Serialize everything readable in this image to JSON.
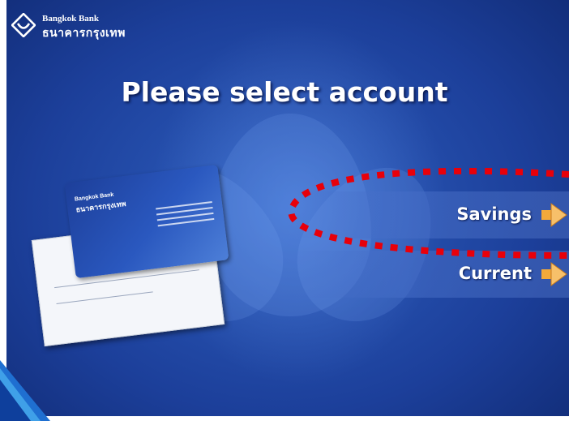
{
  "header": {
    "logo_icon": "bank-emblem-icon",
    "bank_name_en": "Bangkok Bank",
    "bank_name_th": "ธนาคารกรุงเทพ"
  },
  "title": "Please select account",
  "options": [
    {
      "label": "Savings",
      "icon": "arrow-right-icon"
    },
    {
      "label": "Current",
      "icon": "arrow-right-icon"
    }
  ],
  "illustration": {
    "card_brand_en": "Bangkok Bank",
    "card_brand_th": "ธนาคารกรุงเทพ"
  },
  "colors": {
    "background": "#1c3f9a",
    "highlight": "#e8000a",
    "arrow": "#f2a93b"
  }
}
